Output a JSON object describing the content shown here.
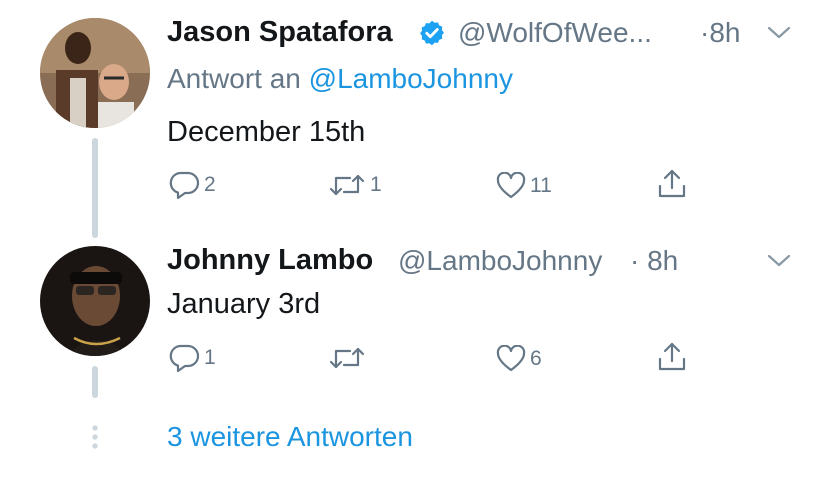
{
  "colors": {
    "accent": "#1b95e0",
    "secondary_text": "#657786",
    "thread_line": "#ccd6dd",
    "verified": "#1da1f2"
  },
  "tweets": [
    {
      "name": "Jason Spatafora",
      "verified": true,
      "handle": "@WolfOfWee...",
      "time": "·8h",
      "reply_prefix": "Antwort an",
      "reply_handle": "@LamboJohnny",
      "text": "December 15th",
      "replies": "2",
      "retweets": "1",
      "likes": "11",
      "icons": [
        "reply-icon",
        "retweet-icon",
        "like-icon",
        "share-icon",
        "chevron-down-icon"
      ]
    },
    {
      "name": "Johnny Lambo",
      "verified": false,
      "handle": "@LamboJohnny",
      "time": "· 8h",
      "text": "January 3rd",
      "replies": "1",
      "retweets": "",
      "likes": "6",
      "icons": [
        "reply-icon",
        "retweet-icon",
        "like-icon",
        "share-icon",
        "chevron-down-icon"
      ]
    }
  ],
  "more_replies_label": "3 weitere Antworten"
}
